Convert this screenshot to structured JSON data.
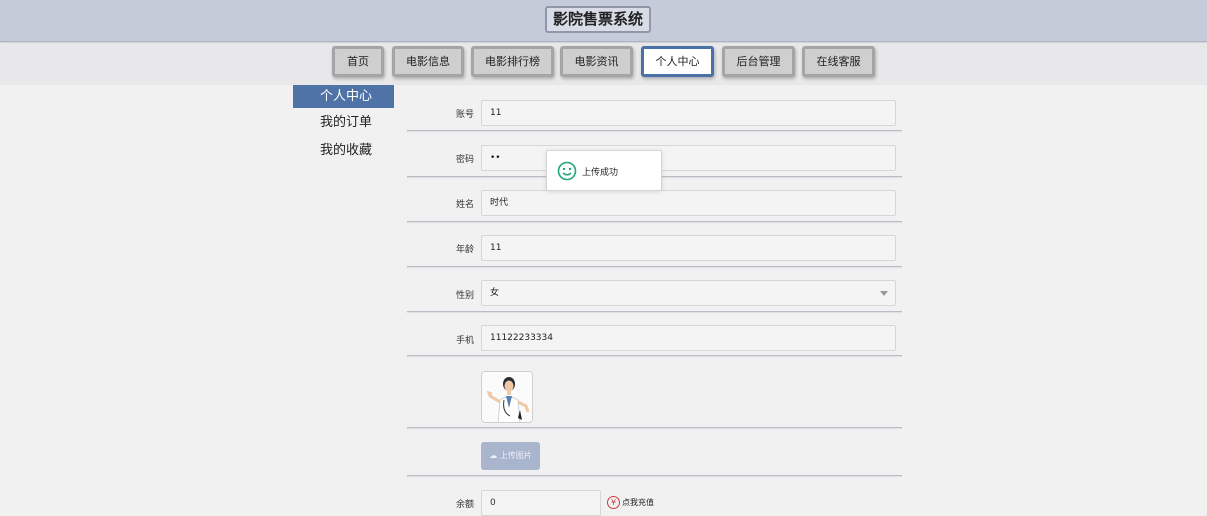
{
  "header": {
    "title": "影院售票系统"
  },
  "nav": {
    "items": [
      {
        "label": "首页"
      },
      {
        "label": "电影信息"
      },
      {
        "label": "电影排行榜"
      },
      {
        "label": "电影资讯"
      },
      {
        "label": "个人中心"
      },
      {
        "label": "后台管理"
      },
      {
        "label": "在线客服"
      }
    ],
    "active": "个人中心"
  },
  "sidebar": {
    "items": [
      {
        "label": "个人中心"
      },
      {
        "label": "我的订单"
      },
      {
        "label": "我的收藏"
      }
    ]
  },
  "form": {
    "account": {
      "label": "账号",
      "value": "11"
    },
    "password": {
      "label": "密码",
      "value": "••"
    },
    "name": {
      "label": "姓名",
      "value": "时代"
    },
    "age": {
      "label": "年龄",
      "value": "11"
    },
    "gender": {
      "label": "性别",
      "value": "女"
    },
    "phone": {
      "label": "手机",
      "value": "11122233334"
    },
    "upload_label": "上传图片",
    "balance": {
      "label": "余额",
      "value": "0",
      "recharge_label": "点我充值"
    }
  },
  "toast": {
    "message": "上传成功"
  },
  "colors": {
    "accent": "#4f73a7",
    "header_bg": "#c5cbd8",
    "success": "#1fa67a",
    "currency": "#d23b3b"
  }
}
